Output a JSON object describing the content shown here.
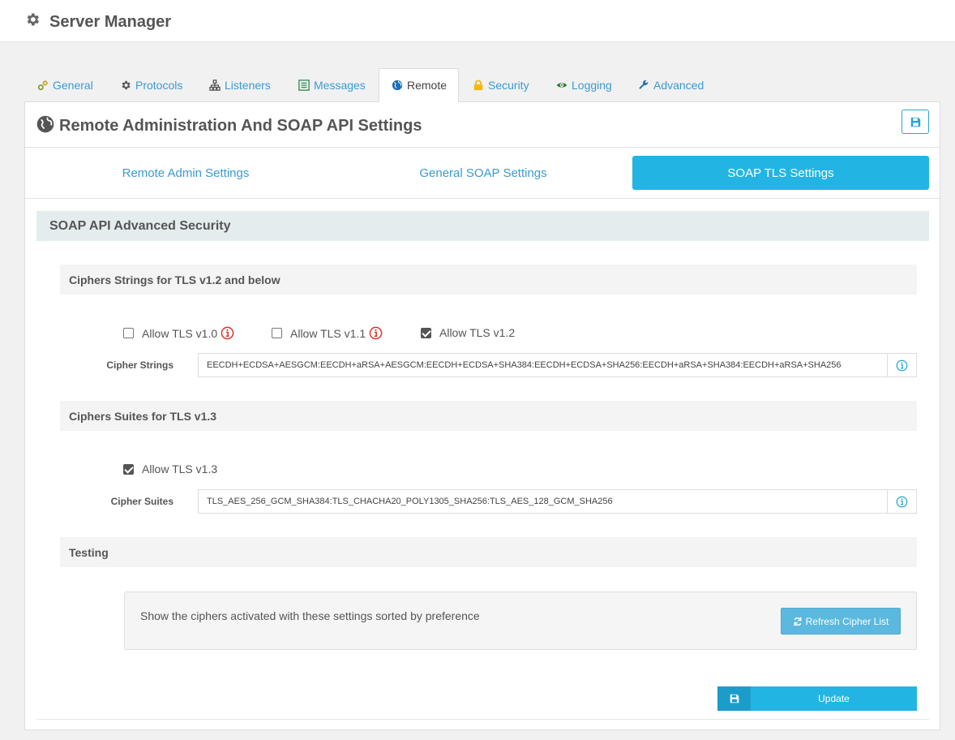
{
  "app": {
    "title": "Server Manager"
  },
  "tabs": [
    {
      "label": "General",
      "icon": "cogs-icon",
      "color": "#8a9a3a"
    },
    {
      "label": "Protocols",
      "icon": "gear-icon",
      "color": "#555555"
    },
    {
      "label": "Listeners",
      "icon": "sitemap-icon",
      "color": "#555555"
    },
    {
      "label": "Messages",
      "icon": "list-icon",
      "color": "#2e8b57"
    },
    {
      "label": "Remote",
      "icon": "globe-icon",
      "color": "#1b6fb5",
      "active": true
    },
    {
      "label": "Security",
      "icon": "lock-icon",
      "color": "#f2b90c"
    },
    {
      "label": "Logging",
      "icon": "eye-icon",
      "color": "#2e7d32"
    },
    {
      "label": "Advanced",
      "icon": "wrench-icon",
      "color": "#1b6fb5"
    }
  ],
  "panel": {
    "title": "Remote Administration And SOAP API Settings",
    "subtabs": [
      {
        "label": "Remote Admin Settings"
      },
      {
        "label": "General SOAP Settings"
      },
      {
        "label": "SOAP TLS Settings",
        "active": true
      }
    ]
  },
  "section": {
    "title": "SOAP API Advanced Security",
    "tls12": {
      "title": "Ciphers Strings for TLS v1.2 and below",
      "options": [
        {
          "label": "Allow TLS v1.0",
          "checked": false,
          "warning": true
        },
        {
          "label": "Allow TLS v1.1",
          "checked": false,
          "warning": true
        },
        {
          "label": "Allow TLS v1.2",
          "checked": true,
          "warning": false
        }
      ],
      "field_label": "Cipher Strings",
      "field_value": "EECDH+ECDSA+AESGCM:EECDH+aRSA+AESGCM:EECDH+ECDSA+SHA384:EECDH+ECDSA+SHA256:EECDH+aRSA+SHA384:EECDH+aRSA+SHA256"
    },
    "tls13": {
      "title": "Ciphers Suites for TLS v1.3",
      "option": {
        "label": "Allow TLS v1.3",
        "checked": true
      },
      "field_label": "Cipher Suites",
      "field_value": "TLS_AES_256_GCM_SHA384:TLS_CHACHA20_POLY1305_SHA256:TLS_AES_128_GCM_SHA256"
    },
    "testing": {
      "title": "Testing",
      "description": "Show the ciphers activated with these settings sorted by preference",
      "refresh_label": "Refresh Cipher List"
    }
  },
  "update_label": "Update",
  "colors": {
    "accent": "#22b5e3",
    "link": "#3a9bd0",
    "warning": "#d9342b"
  }
}
